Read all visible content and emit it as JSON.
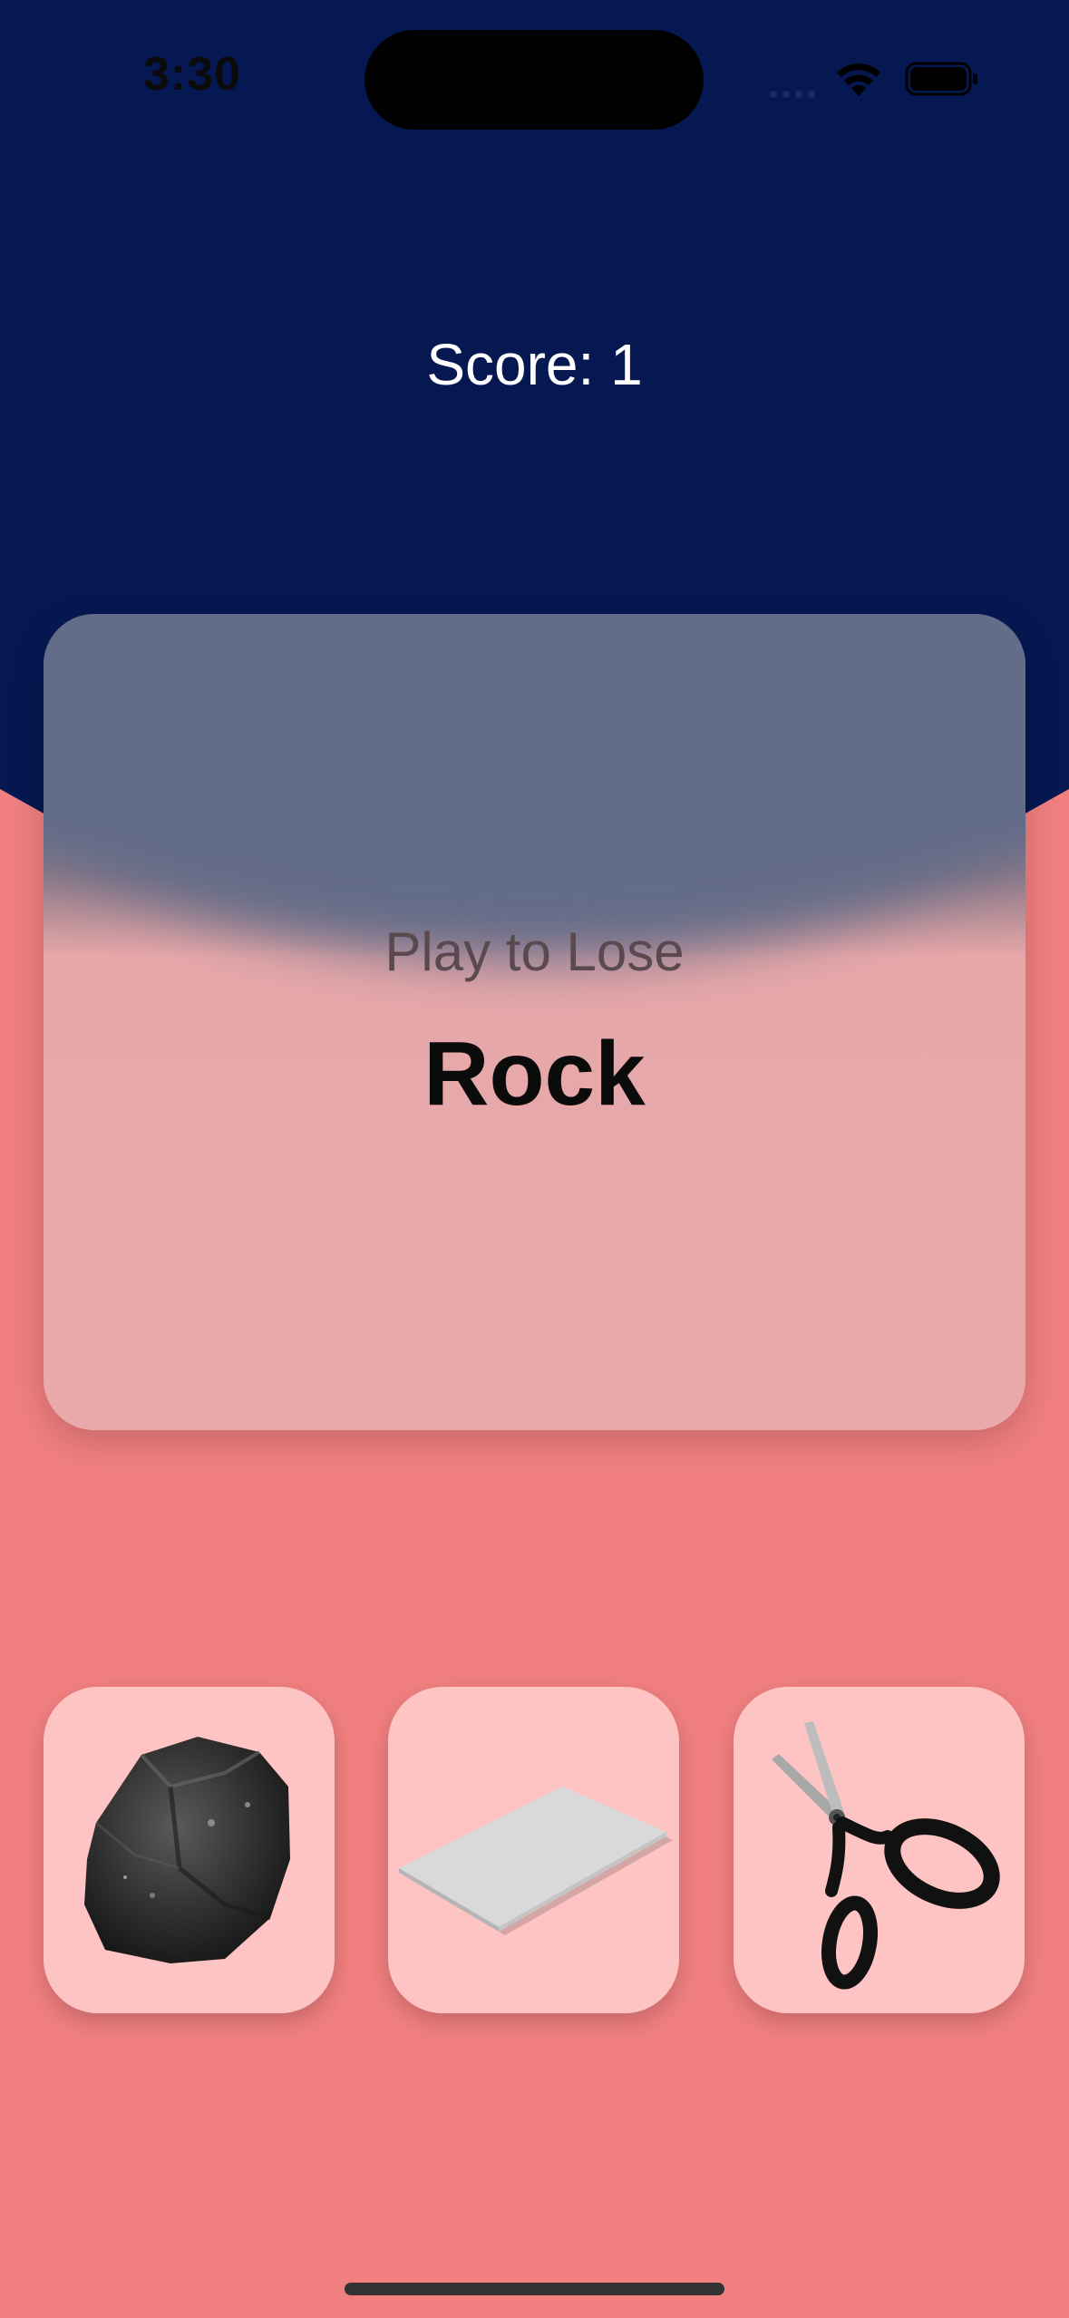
{
  "status_bar": {
    "time": "3:30"
  },
  "game": {
    "score_text": "Score: 1",
    "prompt": "Play to Lose",
    "target_move": "Rock"
  },
  "choices": [
    {
      "name": "rock",
      "icon": "rock-icon"
    },
    {
      "name": "paper",
      "icon": "paper-icon"
    },
    {
      "name": "scissors",
      "icon": "scissors-icon"
    }
  ],
  "colors": {
    "top_background": "#061852",
    "bottom_background": "#f17f7f",
    "choice_tile": "#fec4c4",
    "card_top": "#636c88",
    "card_bottom": "#e9a9aa"
  }
}
